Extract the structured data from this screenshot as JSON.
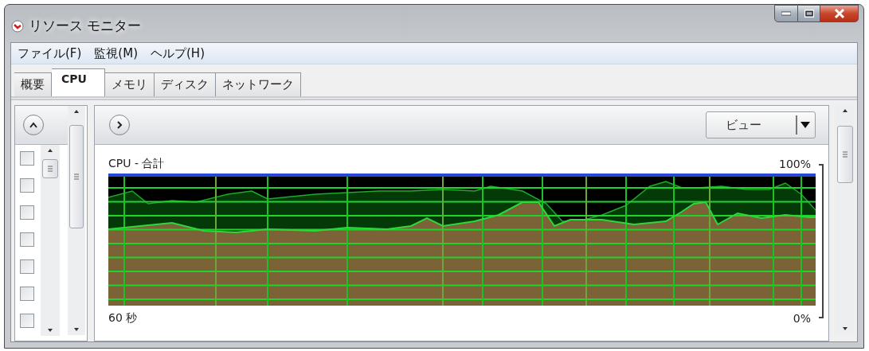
{
  "window": {
    "title": "リソース モニター"
  },
  "menu": [
    {
      "label": "ファイル(F)"
    },
    {
      "label": "監視(M)"
    },
    {
      "label": "ヘルプ(H)"
    }
  ],
  "tabs": [
    {
      "label": "概要",
      "selected": false
    },
    {
      "label": "CPU",
      "selected": true
    },
    {
      "label": "メモリ",
      "selected": false
    },
    {
      "label": "ディスク",
      "selected": false
    },
    {
      "label": "ネットワーク",
      "selected": false
    }
  ],
  "side_panel": {
    "rows": [
      {
        "checked": false
      },
      {
        "checked": false
      },
      {
        "checked": false
      },
      {
        "checked": false
      },
      {
        "checked": false
      },
      {
        "checked": false
      },
      {
        "checked": false
      }
    ]
  },
  "graph_panel": {
    "view_button": "ビュー",
    "graph_title": "CPU - 合計",
    "max_label": "100%",
    "min_label": "0%",
    "time_label": "60 秒"
  }
}
